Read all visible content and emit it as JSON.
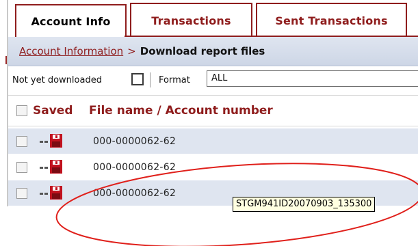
{
  "tabs": [
    {
      "label": "Account Info",
      "active": true
    },
    {
      "label": "Transactions",
      "active": false
    },
    {
      "label": "Sent Transactions",
      "active": false
    }
  ],
  "breadcrumb": {
    "link": "Account Information",
    "separator": ">",
    "current": "Download report files"
  },
  "filter": {
    "status_label": "Not yet downloaded",
    "format_label": "Format",
    "format_value": "ALL"
  },
  "table": {
    "headers": {
      "saved": "Saved",
      "file": "File name / Account number"
    },
    "rows": [
      {
        "file": "000-0000062-62"
      },
      {
        "file": "000-0000062-62"
      },
      {
        "file": "000-0000062-62"
      }
    ]
  },
  "tooltip": {
    "text": "STGM941ID20070903_135300"
  },
  "colors": {
    "accent": "#8f1d1d",
    "row_alt": "#dfe5f0",
    "annotation": "#e0201b"
  },
  "icons": {
    "save": "save-floppy-icon"
  }
}
